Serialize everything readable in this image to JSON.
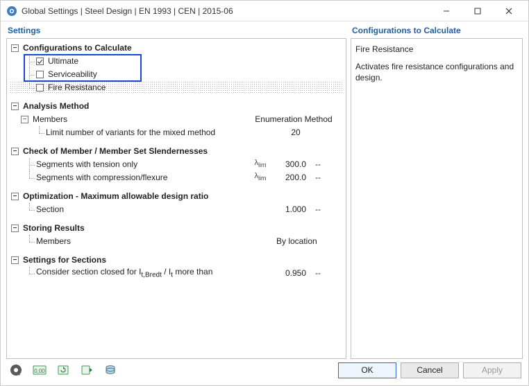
{
  "window": {
    "title": "Global Settings | Steel Design | EN 1993 | CEN | 2015-06"
  },
  "left": {
    "panel_title": "Settings",
    "groups": {
      "configs": {
        "title": "Configurations to Calculate",
        "ultimate": "Ultimate",
        "serviceability": "Serviceability",
        "fire": "Fire Resistance"
      },
      "analysis": {
        "title": "Analysis Method",
        "members": "Members",
        "col_header": "Enumeration Method",
        "limit_variants": "Limit number of variants for the mixed method",
        "limit_variants_val": "20"
      },
      "slender": {
        "title": "Check of Member / Member Set Slendernesses",
        "tension": "Segments with tension only",
        "flex": "Segments with compression/flexure",
        "tension_val": "300.0",
        "flex_val": "200.0",
        "dash": "--"
      },
      "opt": {
        "title": "Optimization - Maximum allowable design ratio",
        "section": "Section",
        "section_val": "1.000",
        "dash": "--"
      },
      "storing": {
        "title": "Storing Results",
        "members": "Members",
        "members_val": "By location"
      },
      "sections": {
        "title": "Settings for Sections",
        "closed": "Consider section closed for I",
        "closed_suffix1": "t,Bredt",
        "closed_mid": " / I",
        "closed_suffix2": "t",
        "closed_rest": " more than",
        "closed_val": "0.950",
        "dash": "--"
      }
    },
    "lambda": "λ",
    "lambda_sub": "lim"
  },
  "right": {
    "panel_title": "Configurations to Calculate",
    "detail_title": "Fire Resistance",
    "detail_body": "Activates fire resistance configurations and design."
  },
  "footer": {
    "ok": "OK",
    "cancel": "Cancel",
    "apply": "Apply"
  }
}
